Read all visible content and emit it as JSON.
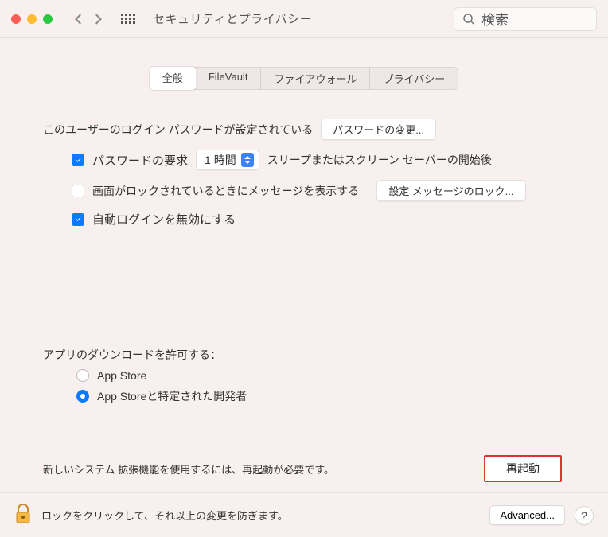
{
  "header": {
    "title": "セキュリティとプライバシー",
    "search_placeholder": "検索"
  },
  "tabs": {
    "general": "全般",
    "filevault": "FileVault",
    "firewall": "ファイアウォール",
    "privacy": "プライバシー"
  },
  "login": {
    "password_set_label": "このユーザーのログイン パスワードが設定されている",
    "change_password_btn": "パスワードの変更...",
    "require_password_label": "パスワードの要求",
    "require_password_delay": "1 時間",
    "require_password_suffix": "スリープまたはスクリーン セーバーの開始後",
    "show_message_label": "画面がロックされているときにメッセージを表示する",
    "set_lock_message_btn": "設定 メッセージのロック...",
    "disable_autologin_label": "自動ログインを無効にする"
  },
  "downloads": {
    "heading": "アプリのダウンロードを許可する：",
    "appstore": "App Store",
    "identified": "App Storeと特定された開発者"
  },
  "restart": {
    "message": "新しいシステム 拡張機能を使用するには、再起動が必要です。",
    "button": "再起動"
  },
  "footer": {
    "lock_text": "ロックをクリックして、それ以上の変更を防ぎます。",
    "advanced": "Advanced...",
    "help": "?"
  }
}
